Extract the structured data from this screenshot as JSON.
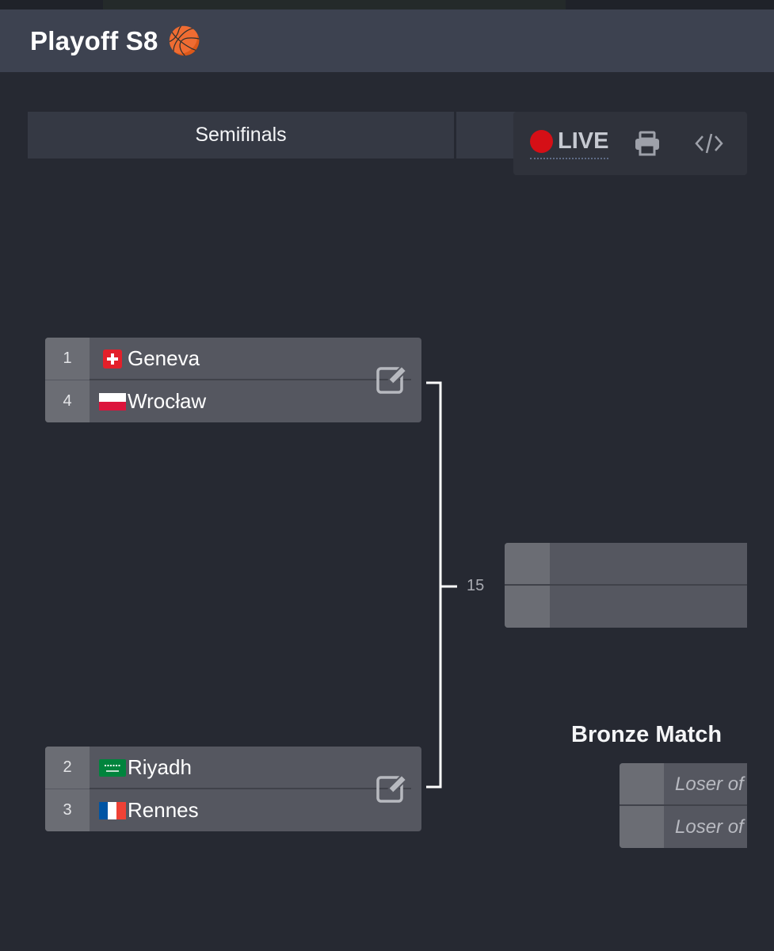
{
  "header": {
    "title": "Playoff S8",
    "emoji": "🏀"
  },
  "rounds": [
    {
      "label": "Semifinals"
    },
    {
      "label": ""
    }
  ],
  "toolbar": {
    "live_label": "LIVE",
    "icons": [
      "live-dot-icon",
      "print-icon",
      "code-icon"
    ]
  },
  "semifinals": [
    {
      "teams": [
        {
          "seed": "1",
          "name": "Geneva",
          "flag": "switzerland"
        },
        {
          "seed": "4",
          "name": "Wrocław",
          "flag": "poland"
        }
      ]
    },
    {
      "teams": [
        {
          "seed": "2",
          "name": "Riyadh",
          "flag": "saudi-arabia"
        },
        {
          "seed": "3",
          "name": "Rennes",
          "flag": "france"
        }
      ]
    }
  ],
  "final": {
    "match_number": "15"
  },
  "bronze": {
    "title": "Bronze Match",
    "placeholders": [
      "Loser of",
      "Loser of"
    ]
  },
  "colors": {
    "background": "#262932",
    "header": "#3d4250",
    "live": "#d50f16",
    "match_body": "#555760",
    "seed_cell": "#6b6d74"
  }
}
